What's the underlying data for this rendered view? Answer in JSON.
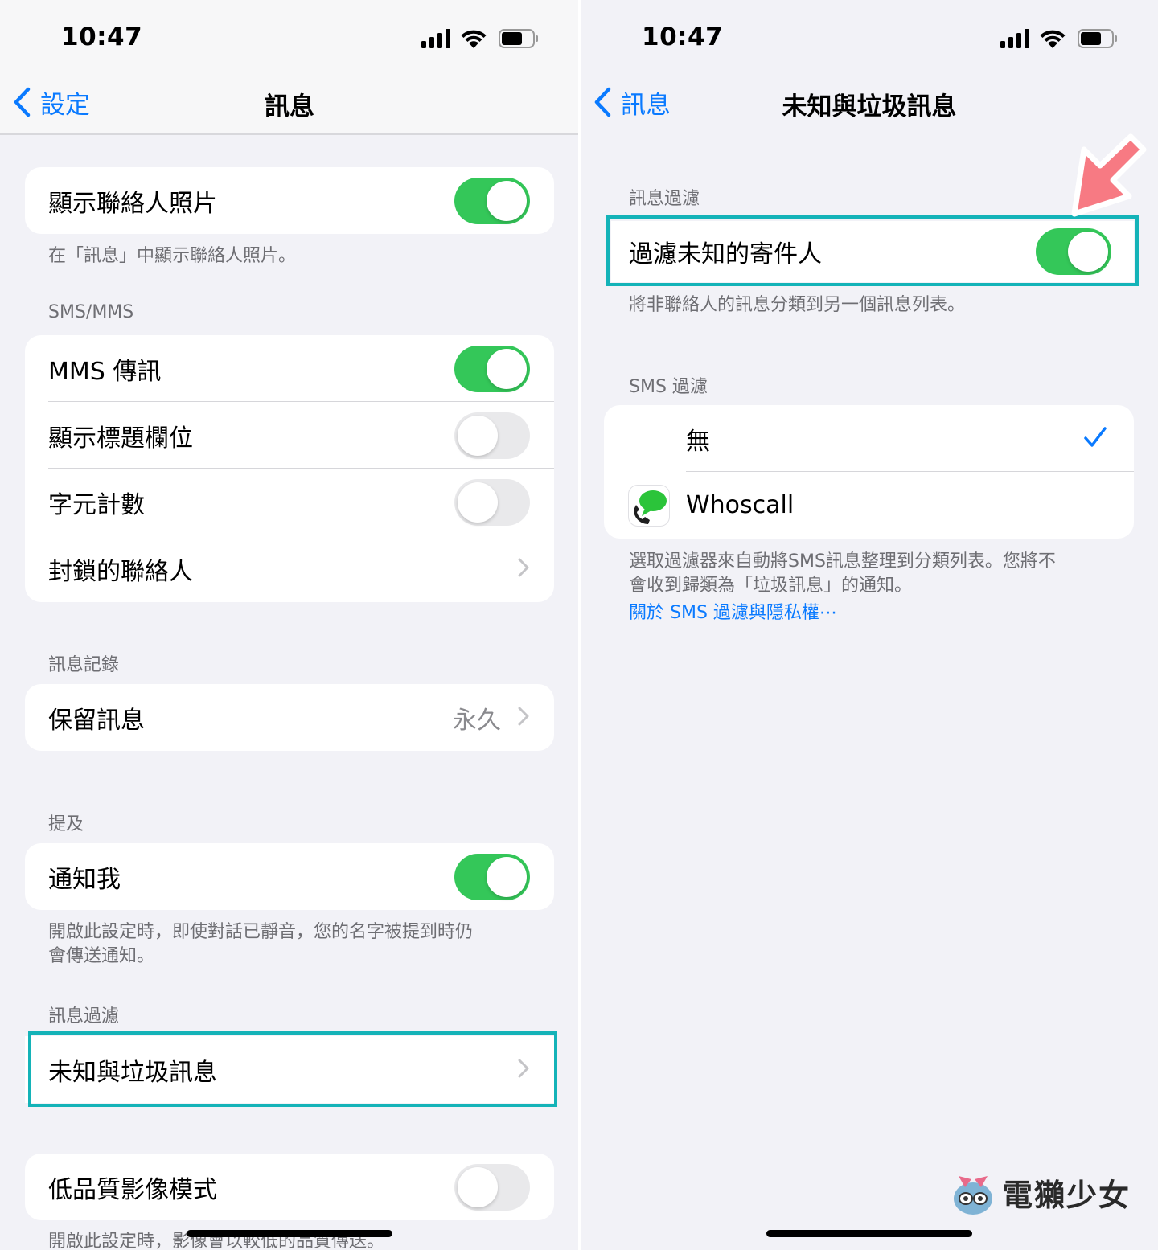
{
  "left": {
    "status_time": "10:47",
    "nav": {
      "back_label": "設定",
      "title": "訊息"
    },
    "contact_photos": {
      "label": "顯示聯絡人照片",
      "on": true,
      "footer": "在「訊息」中顯示聯絡人照片。"
    },
    "sms_mms": {
      "header": "SMS/MMS",
      "rows": [
        {
          "label": "MMS 傳訊",
          "on": true
        },
        {
          "label": "顯示標題欄位",
          "on": false
        },
        {
          "label": "字元計數",
          "on": false
        },
        {
          "label": "封鎖的聯絡人"
        }
      ]
    },
    "history": {
      "header": "訊息記錄",
      "keep_label": "保留訊息",
      "keep_value": "永久"
    },
    "mentions": {
      "header": "提及",
      "notify_label": "通知我",
      "on": true,
      "footer_line1": "開啟此設定時，即使對話已靜音，您的名字被提到時仍",
      "footer_line2": "會傳送通知。"
    },
    "filter": {
      "header": "訊息過濾",
      "unknown_label": "未知與垃圾訊息"
    },
    "low_quality": {
      "label": "低品質影像模式",
      "on": false,
      "footer": "開啟此設定時，影像會以較低的品質傳送。"
    }
  },
  "right": {
    "status_time": "10:47",
    "nav": {
      "back_label": "訊息",
      "title": "未知與垃圾訊息"
    },
    "message_filter": {
      "header": "訊息過濾",
      "filter_unknown_label": "過濾未知的寄件人",
      "on": true,
      "footer": "將非聯絡人的訊息分類到另一個訊息列表。"
    },
    "sms_filter": {
      "header": "SMS 過濾",
      "options": [
        {
          "label": "無",
          "selected": true
        },
        {
          "label": "Whoscall",
          "selected": false
        }
      ],
      "footer_line1": "選取過濾器來自動將SMS訊息整理到分類列表。您將不",
      "footer_line2": "會收到歸類為「垃圾訊息」的通知。",
      "link": "關於 SMS 過濾與隱私權⋯"
    },
    "watermark": "電獺少女"
  },
  "colors": {
    "accent": "#0a7aff",
    "toggle_on": "#34c759",
    "highlight": "#14b3b8",
    "arrow": "#f77a83"
  }
}
